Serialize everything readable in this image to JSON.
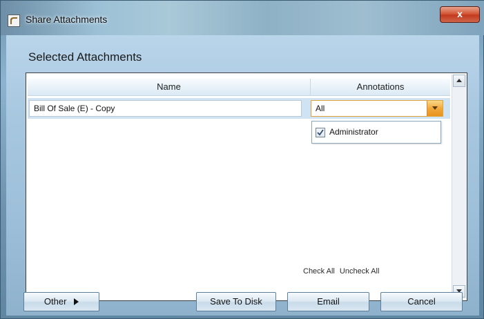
{
  "window": {
    "title": "Share Attachments",
    "close_label": "x"
  },
  "section": {
    "title": "Selected Attachments"
  },
  "grid": {
    "columns": [
      "Name",
      "Annotations"
    ],
    "rows": [
      {
        "name": "Bill Of Sale (E) - Copy",
        "annotations": "All"
      }
    ]
  },
  "annotations_dropdown": {
    "items": [
      {
        "label": "Administrator",
        "checked": true
      }
    ]
  },
  "check_links": {
    "check_all": "Check All",
    "uncheck_all": "Uncheck All"
  },
  "buttons": {
    "other": "Other",
    "save_to_disk": "Save To Disk",
    "email": "Email",
    "cancel": "Cancel"
  },
  "colors": {
    "accent": "#e8931e",
    "close": "#c23a1e",
    "selected_row": "#cfe3f3"
  }
}
